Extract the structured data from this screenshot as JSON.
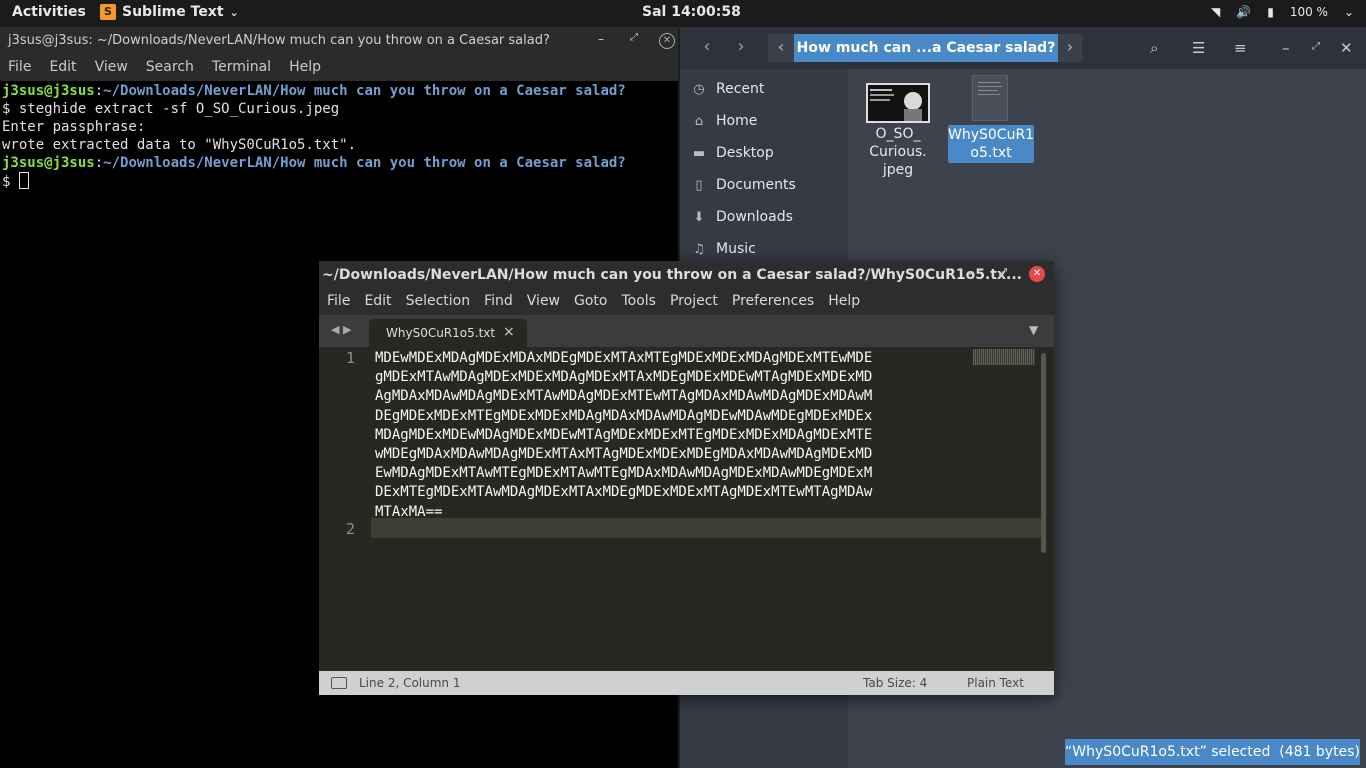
{
  "topbar": {
    "activities": "Activities",
    "app_name": "Sublime Text",
    "app_icon": "S",
    "clock": "Sal 14:00:58",
    "battery": "100 %"
  },
  "terminal": {
    "title": "j3sus@j3sus: ~/Downloads/NeverLAN/How much can you throw on a Caesar salad?",
    "menu": [
      "File",
      "Edit",
      "View",
      "Search",
      "Terminal",
      "Help"
    ],
    "lines": [
      {
        "user": "j3sus@j3sus",
        "path": "~/Downloads/NeverLAN/How much can you throw on a Caesar salad?"
      },
      {
        "text": "$ steghide extract -sf O_SO_Curious.jpeg"
      },
      {
        "text": "Enter passphrase:"
      },
      {
        "text": "wrote extracted data to \"WhyS0CuR1o5.txt\"."
      },
      {
        "user": "j3sus@j3sus",
        "path": "~/Downloads/NeverLAN/How much can you throw on a Caesar salad?"
      },
      {
        "text": "$ "
      }
    ]
  },
  "files": {
    "path_segment": "How much can ...a Caesar salad?",
    "sidebar": [
      "Recent",
      "Home",
      "Desktop",
      "Documents",
      "Downloads",
      "Music"
    ],
    "items": [
      {
        "name": "O_SO_\nCurious.\njpeg"
      },
      {
        "name": "WhyS0CuR1\no5.txt"
      }
    ],
    "status": "“WhyS0CuR1o5.txt” selected  (481 bytes)"
  },
  "sublime": {
    "title": "~/Downloads/NeverLAN/How much can you throw on a Caesar salad?/WhyS0CuR1o5.tx...",
    "menu": [
      "File",
      "Edit",
      "Selection",
      "Find",
      "View",
      "Goto",
      "Tools",
      "Project",
      "Preferences",
      "Help"
    ],
    "tab_label": "WhyS0CuR1o5.txt",
    "line_numbers": [
      "1",
      "2"
    ],
    "code": "MDEwMDExMDAgMDExMDAxMDEgMDExMTAxMTEgMDExMDExMDAgMDExMTEwMDE\ngMDExMTAwMDAgMDExMDExMDAgMDExMTAxMDEgMDExMDEwMTAgMDExMDExMD\nAgMDAxMDAwMDAgMDExMTAwMDAgMDExMTEwMTAgMDAxMDAwMDAgMDExMDAwM\nDEgMDExMDExMTEgMDExMDExMDAgMDAxMDAwMDAgMDEwMDAwMDEgMDExMDEx\nMDAgMDExMDEwMDAgMDExMDEwMTAgMDExMDExMTEgMDExMDExMDAgMDExMTE\nwMDEgMDAxMDAwMDAgMDExMTAxMTAgMDExMDExMDEgMDAxMDAwMDAgMDExMD\nEwMDAgMDExMTAwMTEgMDExMTAwMTEgMDAxMDAwMDAgMDExMDAwMDEgMDExM\nDExMTEgMDExMTAwMDAgMDExMTAxMDEgMDExMDExMTAgMDExMTEwMTAgMDAw\nMTAxMA==",
    "status_position": "Line 2, Column 1",
    "status_tabsize": "Tab Size: 4",
    "status_syntax": "Plain Text"
  }
}
